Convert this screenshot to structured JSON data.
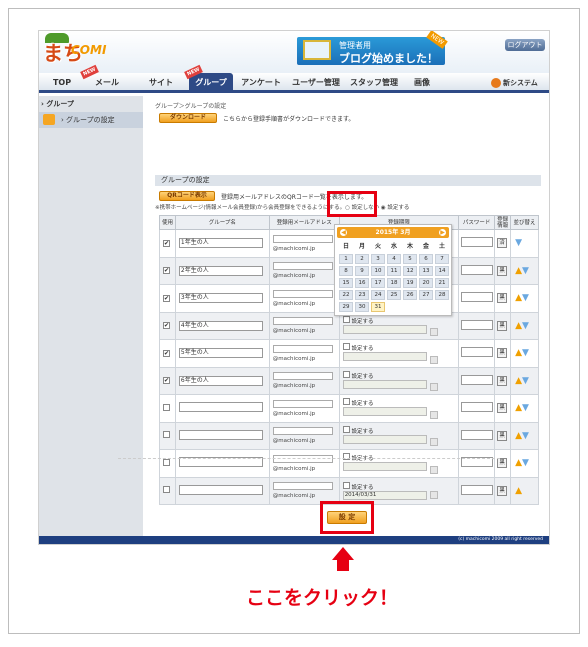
{
  "header": {
    "logo_text_ma": "まち",
    "logo_text_comi": "COMI",
    "banner_line1": "管理者用",
    "banner_line2": "ブログ始めました！",
    "banner_new": "NEW",
    "logout_label": "ログアウト"
  },
  "nav": {
    "items": [
      "TOP",
      "メール",
      "サイト",
      "グループ",
      "アンケート",
      "ユーザー管理",
      "スタッフ管理",
      "画像"
    ],
    "new_tag": "NEW",
    "new_system": "新システム"
  },
  "sidebar": {
    "heading": "グループ",
    "items": [
      {
        "label": "グループの設定"
      }
    ]
  },
  "main": {
    "breadcrumb": "グループ＞グループの設定",
    "download_label": "ダウンロード",
    "download_desc": "こちらから登録手順書がダウンロードできます。",
    "section_title": "グループの設定",
    "qr_label": "QRコード表示",
    "qr_desc": "登録用メールアドレスのQRコード一覧を表示します。",
    "note": "※携帯ホームページ(情報メール会員登録)から会員登録をできるようにする。○ 設定しない ◉ 設定する"
  },
  "table": {
    "headers": [
      "使用",
      "グループ名",
      "登録用メールアドレス",
      "登録期限",
      "パスワード",
      "登録情報",
      "並び替え"
    ],
    "mail_domain": "@machicomi.jp",
    "date_cb_label": "設定する",
    "kuro_label": "黒",
    "rows": [
      {
        "checked": "✔",
        "name": "1年生の人",
        "date_checked": "✔",
        "date": "",
        "kuro": "済"
      },
      {
        "checked": "✔",
        "name": "2年生の人",
        "date_checked": "",
        "date": "",
        "kuro": "黒"
      },
      {
        "checked": "✔",
        "name": "3年生の人",
        "date_checked": "",
        "date": "",
        "kuro": "黒"
      },
      {
        "checked": "✔",
        "name": "4年生の人",
        "date_checked": "",
        "date": "",
        "kuro": "黒"
      },
      {
        "checked": "✔",
        "name": "5年生の人",
        "date_checked": "",
        "date": "",
        "kuro": "黒"
      },
      {
        "checked": "✔",
        "name": "6年生の人",
        "date_checked": "",
        "date": "",
        "kuro": "黒"
      },
      {
        "checked": "",
        "name": "",
        "date_checked": "",
        "date": "",
        "kuro": "黒"
      },
      {
        "checked": "",
        "name": "",
        "date_checked": "",
        "date": "",
        "kuro": "黒"
      },
      {
        "checked": "",
        "name": "",
        "date_checked": "",
        "date": "",
        "kuro": "黒"
      },
      {
        "checked": "",
        "name": "",
        "date_checked": "",
        "date": "2014/03/31",
        "kuro": "黒"
      }
    ]
  },
  "calendar": {
    "title": "2015年 3月",
    "dows": [
      "日",
      "月",
      "火",
      "水",
      "木",
      "金",
      "土"
    ],
    "days": [
      "1",
      "2",
      "3",
      "4",
      "5",
      "6",
      "7",
      "8",
      "9",
      "10",
      "11",
      "12",
      "13",
      "14",
      "15",
      "16",
      "17",
      "18",
      "19",
      "20",
      "21",
      "22",
      "23",
      "24",
      "25",
      "26",
      "27",
      "28",
      "29",
      "30",
      "31"
    ],
    "today": "31"
  },
  "bottom": {
    "set_label": "設 定",
    "footer": "(c) machicomi 2009 all right reserved",
    "click_text": "ここをクリック！"
  },
  "colors": {
    "highlight": "#e60012",
    "nav_active": "#2e4a86",
    "orange_button": "#f0a020"
  }
}
